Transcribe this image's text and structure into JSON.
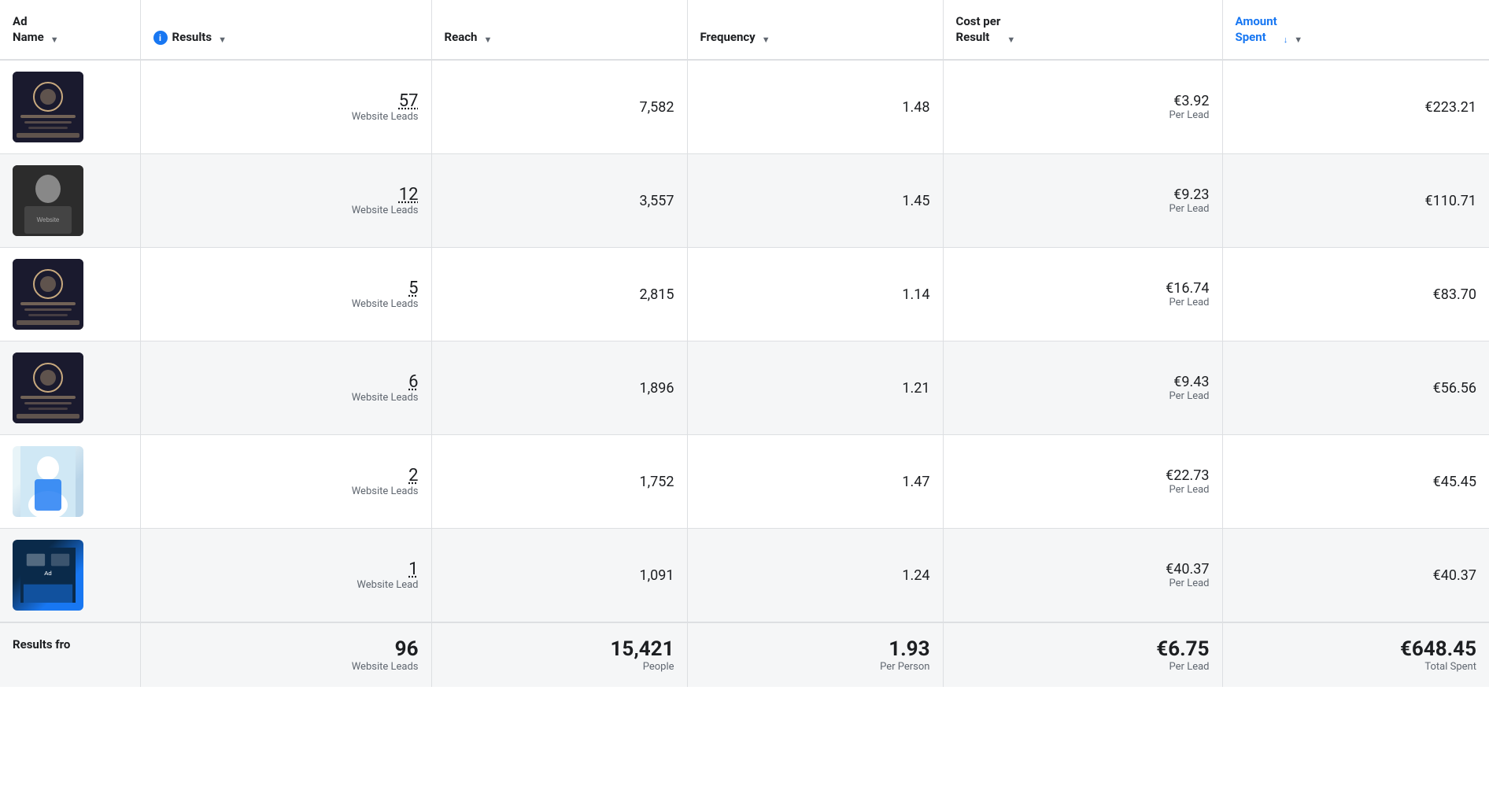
{
  "header": {
    "col_adname": "Ad\nName",
    "col_results": "Results",
    "col_reach": "Reach",
    "col_frequency": "Frequency",
    "col_cpr": "Cost per\nResult",
    "col_amount": "Amount\nSpent",
    "sort_arrow": "▼",
    "sort_arrow_down": "↓",
    "info_icon": "i"
  },
  "rows": [
    {
      "id": 1,
      "thumb_class": "thumb-1",
      "results_number": "57",
      "results_label": "Website Leads",
      "reach": "7,582",
      "frequency": "1.48",
      "cpr_amount": "€3.92",
      "cpr_label": "Per Lead",
      "amount": "€223.21"
    },
    {
      "id": 2,
      "thumb_class": "thumb-2",
      "results_number": "12",
      "results_label": "Website Leads",
      "reach": "3,557",
      "frequency": "1.45",
      "cpr_amount": "€9.23",
      "cpr_label": "Per Lead",
      "amount": "€110.71"
    },
    {
      "id": 3,
      "thumb_class": "thumb-3",
      "results_number": "5",
      "results_label": "Website Leads",
      "reach": "2,815",
      "frequency": "1.14",
      "cpr_amount": "€16.74",
      "cpr_label": "Per Lead",
      "amount": "€83.70"
    },
    {
      "id": 4,
      "thumb_class": "thumb-4",
      "results_number": "6",
      "results_label": "Website Leads",
      "reach": "1,896",
      "frequency": "1.21",
      "cpr_amount": "€9.43",
      "cpr_label": "Per Lead",
      "amount": "€56.56"
    },
    {
      "id": 5,
      "thumb_class": "thumb-5",
      "results_number": "2",
      "results_label": "Website Leads",
      "reach": "1,752",
      "frequency": "1.47",
      "cpr_amount": "€22.73",
      "cpr_label": "Per Lead",
      "amount": "€45.45"
    },
    {
      "id": 6,
      "thumb_class": "thumb-6",
      "results_number": "1",
      "results_label": "Website Lead",
      "reach": "1,091",
      "frequency": "1.24",
      "cpr_amount": "€40.37",
      "cpr_label": "Per Lead",
      "amount": "€40.37"
    }
  ],
  "footer": {
    "label": "Results fro",
    "results_number": "96",
    "results_label": "Website Leads",
    "reach": "15,421",
    "reach_sublabel": "People",
    "frequency": "1.93",
    "frequency_sublabel": "Per Person",
    "cpr": "€6.75",
    "cpr_sublabel": "Per Lead",
    "amount": "€648.45",
    "amount_sublabel": "Total Spent"
  }
}
